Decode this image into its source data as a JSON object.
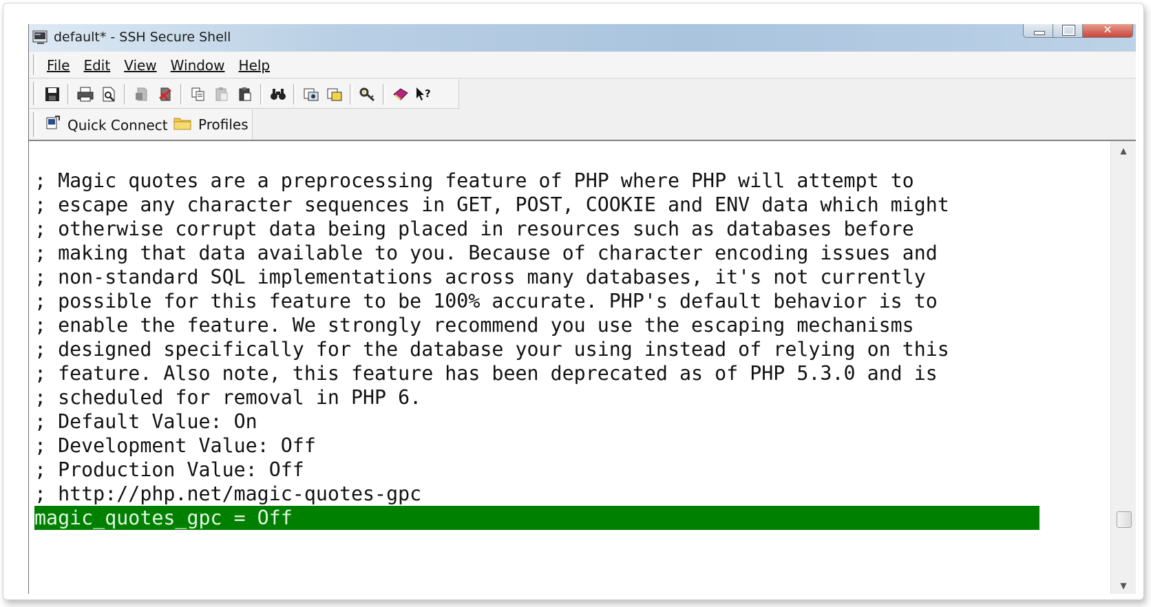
{
  "window": {
    "title": "default* - SSH Secure Shell"
  },
  "menu": [
    "File",
    "Edit",
    "View",
    "Window",
    "Help"
  ],
  "toolbar": {
    "icons": [
      "save-icon",
      "print-icon",
      "print-preview-icon",
      "disconnect-icon",
      "disconnected-icon",
      "copy-icon",
      "paste-icon",
      "paste-clipboard-icon",
      "find-icon",
      "settings-icon",
      "profile-icon",
      "key-icon",
      "help-book-icon",
      "context-help-icon"
    ]
  },
  "quickbar": {
    "quick_connect": "Quick Connect",
    "profiles": "Profiles"
  },
  "terminal": {
    "lines": [
      "; Magic quotes are a preprocessing feature of PHP where PHP will attempt to",
      "; escape any character sequences in GET, POST, COOKIE and ENV data which might",
      "; otherwise corrupt data being placed in resources such as databases before",
      "; making that data available to you. Because of character encoding issues and",
      "; non-standard SQL implementations across many databases, it's not currently",
      "; possible for this feature to be 100% accurate. PHP's default behavior is to",
      "; enable the feature. We strongly recommend you use the escaping mechanisms",
      "; designed specifically for the database your using instead of relying on this",
      "; feature. Also note, this feature has been deprecated as of PHP 5.3.0 and is",
      "; scheduled for removal in PHP 6.",
      "; Default Value: On",
      "; Development Value: Off",
      "; Production Value: Off",
      "; http://php.net/magic-quotes-gpc",
      "magic_quotes_gpc = Off"
    ],
    "highlighted_line": 14,
    "highlight_color": "#008000"
  }
}
